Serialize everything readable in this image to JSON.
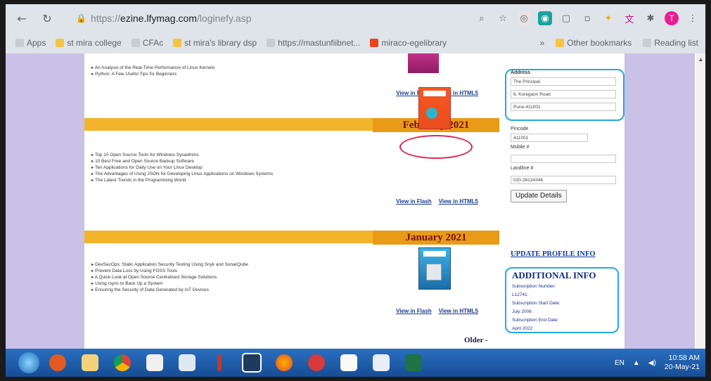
{
  "browser": {
    "url_proto": "https://",
    "url_host": "ezine.lfymag.com",
    "url_path": "/loginefy.asp",
    "bookmarks": [
      {
        "label": "Apps",
        "kind": "apps"
      },
      {
        "label": "st mira college",
        "kind": "page"
      },
      {
        "label": "CFAc",
        "kind": "page"
      },
      {
        "label": "st mira's library dsp",
        "kind": "page"
      },
      {
        "label": "https://mastunfiibnet...",
        "kind": "page"
      },
      {
        "label": "miraco-egelibrary",
        "kind": "red"
      }
    ],
    "overflow": "»",
    "other_bookmarks": "Other bookmarks",
    "reading_list": "Reading list",
    "profile_initial": "T"
  },
  "issues": {
    "top": {
      "articles": [
        "An Analysis of the Real-Time Performance of Linux Kernels",
        "Python: A Few Useful Tips for Beginners"
      ],
      "view_flash": "View in Flash",
      "view_html5": "View in HTML5"
    },
    "feb": {
      "month": "February 2021",
      "articles": [
        "Top 10 Open Source Tools for Windows Sysadmins",
        "10 Best Free and Open Source Backup Software",
        "Ten Applications for Daily Use on Your Linux Desktop",
        "The Advantages of Using JSON for Developing Linux Applications on Windows Systems",
        "The Latest Trends in the Programming World"
      ],
      "view_flash": "View in Flash",
      "view_html5": "View in HTML5"
    },
    "jan": {
      "month": "January 2021",
      "articles": [
        "DevSecOps: Static Application Security Testing Using Snyk and SonarQube",
        "Prevent Data Loss by Using FOSS Tools",
        "A Quick Look at Open Source Centralised Storage Solutions",
        "Using rsync to Back Up a System",
        "Ensuring the Security of Data Generated by IoT Devices"
      ],
      "view_flash": "View in Flash",
      "view_html5": "View in HTML5"
    },
    "older": "Older -"
  },
  "profile": {
    "address_label": "Address",
    "address_lines": [
      "The Principal",
      "6, Koregaon Road",
      "Pune-411001"
    ],
    "pincode_label": "Pincode",
    "pincode": "411001",
    "mobile_label": "Mobile #",
    "mobile": "",
    "landline_label": "Landline #",
    "landline": "020-26134346",
    "update_button": "Update Details",
    "update_profile_link": "UPDATE PROFILE INFO",
    "additional_title": "ADDITIONAL INFO",
    "subscription_number_label": "Subscription Number:",
    "subscription_number": "L12741",
    "start_label": "Subscription Start Date:",
    "start_date": "July 2006",
    "end_label": "Subscription End Date:",
    "end_date": "April 2022"
  },
  "taskbar": {
    "lang": "EN",
    "time": "10:58 AM",
    "date": "20-May-21"
  }
}
